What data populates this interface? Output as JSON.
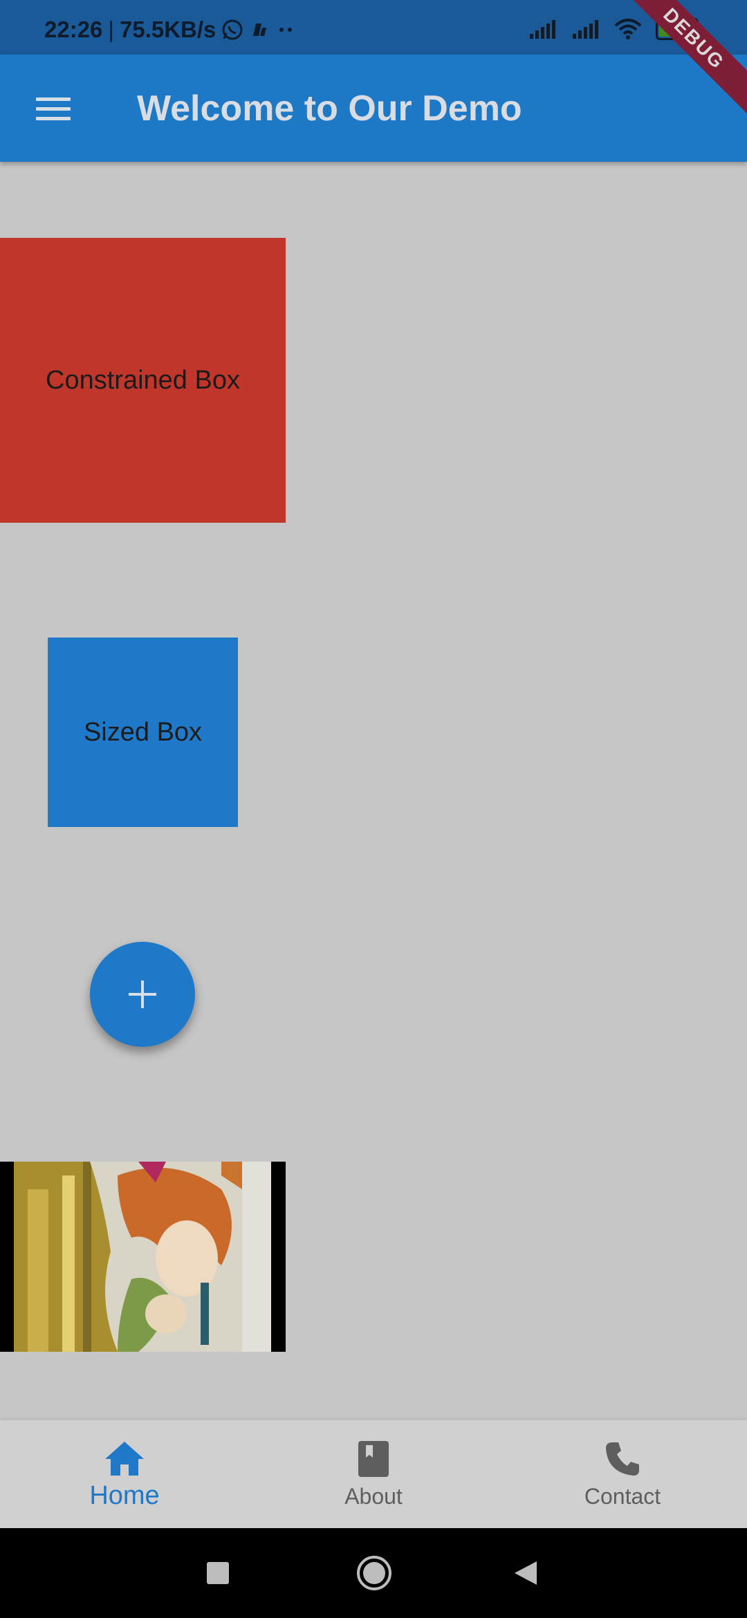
{
  "status_bar": {
    "time": "22:26",
    "separator": "|",
    "network_speed": "75.5KB/s",
    "battery_level": "55",
    "icons": [
      "whatsapp-icon",
      "app-notification-icon",
      "more-dots-icon",
      "signal-icon",
      "signal-icon",
      "wifi-icon",
      "battery-icon"
    ]
  },
  "app_bar": {
    "title": "Welcome to Our Demo",
    "menu_icon": "hamburger-menu-icon",
    "debug_banner": "DEBUG"
  },
  "content": {
    "constrained_box_label": "Constrained Box",
    "sized_box_label": "Sized Box",
    "fab_icon": "plus-icon"
  },
  "bottom_nav": {
    "items": [
      {
        "label": "Home",
        "icon": "home-icon",
        "active": true
      },
      {
        "label": "About",
        "icon": "book-icon",
        "active": false
      },
      {
        "label": "Contact",
        "icon": "phone-icon",
        "active": false
      }
    ]
  },
  "colors": {
    "app_bar": "#1d78c6",
    "status_bar": "#1a5a99",
    "background": "#c6c6c6",
    "constrained_box": "#c0362b",
    "sized_box": "#1f79c8",
    "accent": "#1f79c8",
    "debug_banner": "#7d1e36"
  }
}
